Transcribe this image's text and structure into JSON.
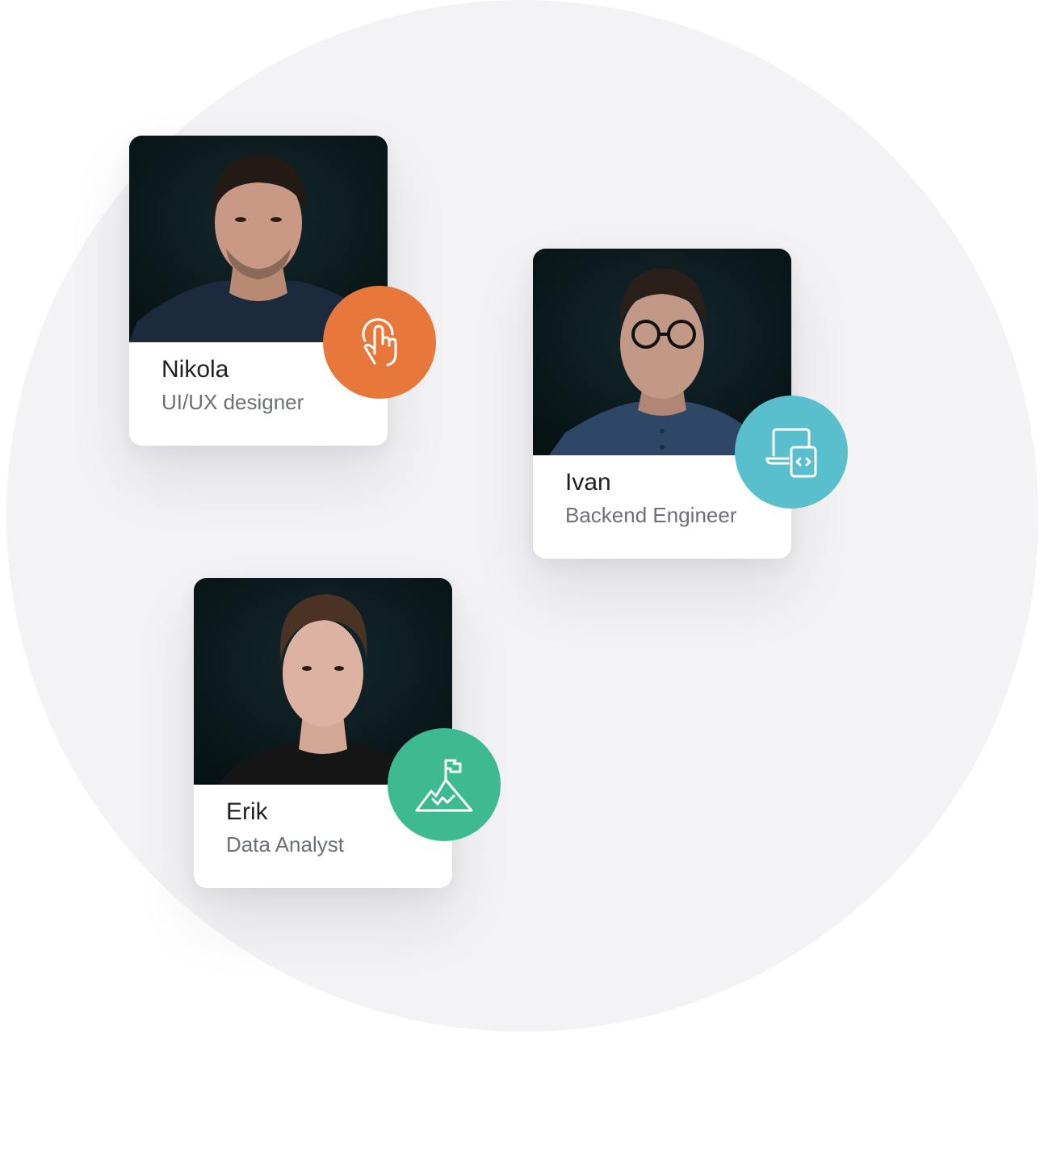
{
  "members": [
    {
      "name": "Nikola",
      "role": "UI/UX designer",
      "icon": "touch-pointer-icon",
      "accent": "#e8773c"
    },
    {
      "name": "Ivan",
      "role": "Backend Engineer",
      "icon": "laptop-code-icon",
      "accent": "#59bfcc"
    },
    {
      "name": "Erik",
      "role": "Data Analyst",
      "icon": "mountain-flag-icon",
      "accent": "#3dba8f"
    }
  ],
  "colors": {
    "background_circle": "#f3f3f5",
    "photo_background": "#0c1b1e",
    "name_text": "#1f1f24",
    "role_text": "#6d6f78"
  }
}
